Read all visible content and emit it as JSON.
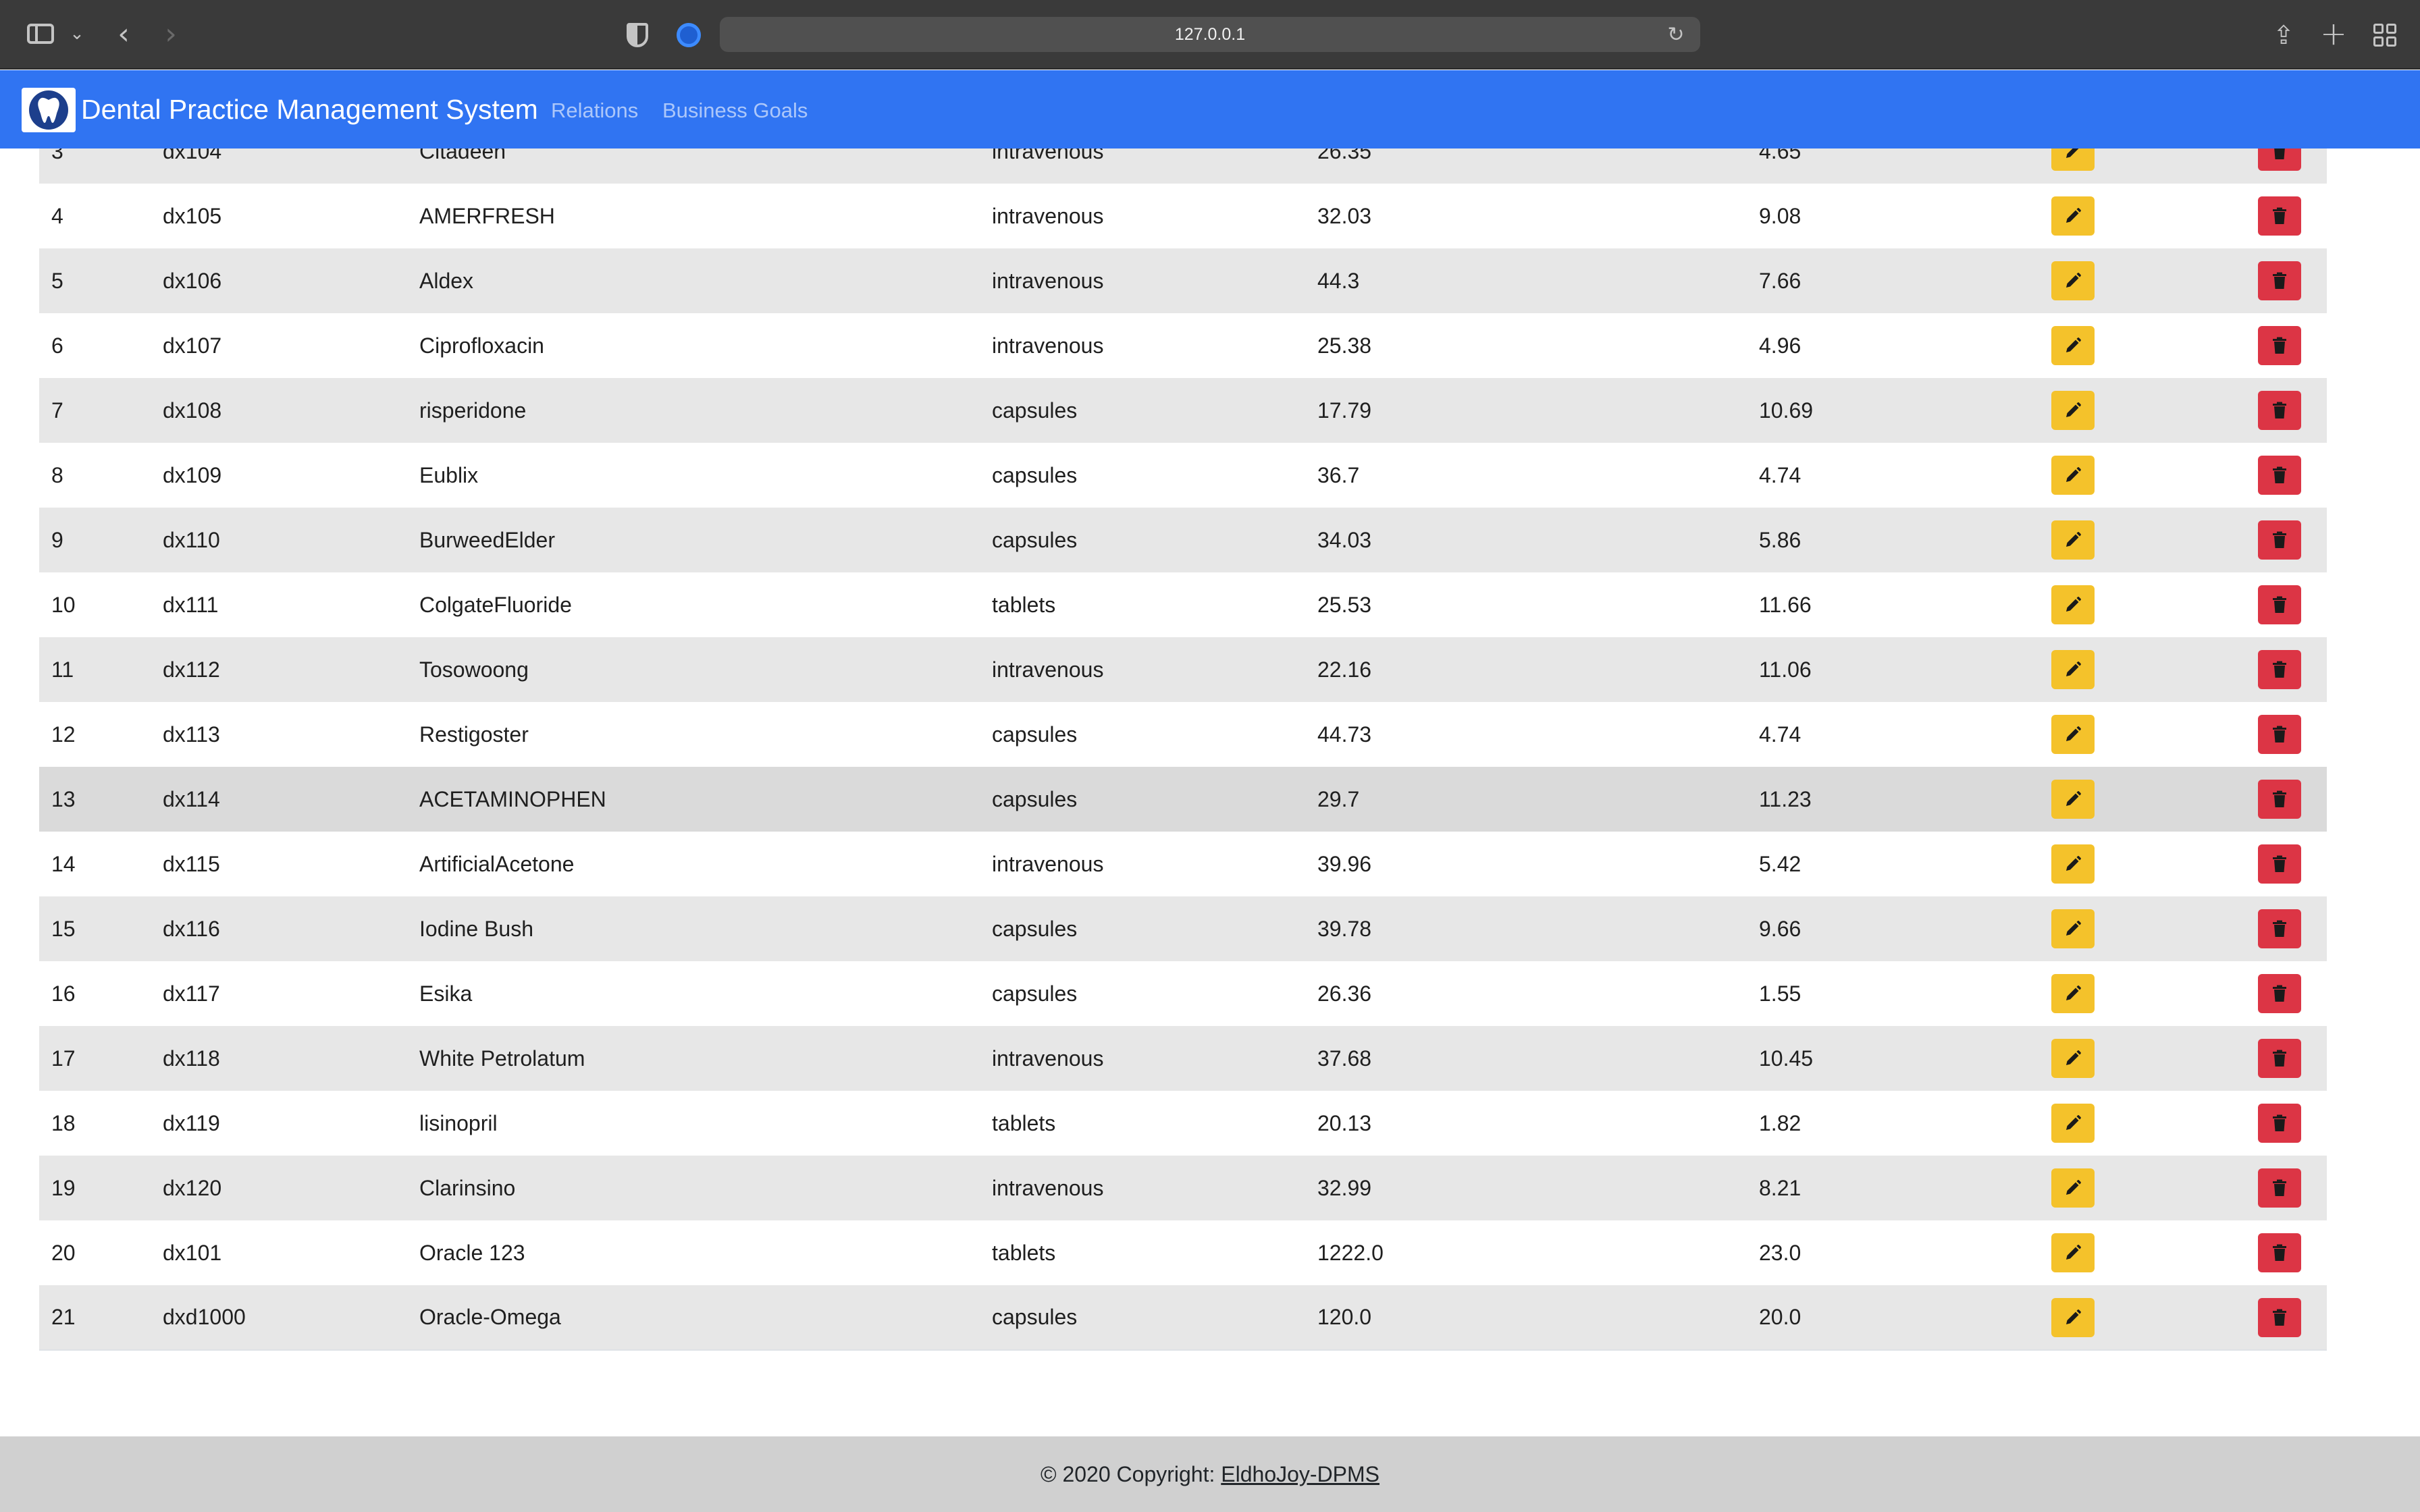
{
  "browser": {
    "url": "127.0.0.1"
  },
  "navbar": {
    "brand_title": "Dental Practice Management System",
    "links": [
      {
        "label": "Relations"
      },
      {
        "label": "Business Goals"
      }
    ],
    "brand_color": "#3074f2"
  },
  "table": {
    "rows": [
      {
        "n": "3",
        "code": "dx104",
        "name": "Citadeen",
        "type": "intravenous",
        "price": "26.35",
        "qty": "4.65"
      },
      {
        "n": "4",
        "code": "dx105",
        "name": "AMERFRESH",
        "type": "intravenous",
        "price": "32.03",
        "qty": "9.08"
      },
      {
        "n": "5",
        "code": "dx106",
        "name": "Aldex",
        "type": "intravenous",
        "price": "44.3",
        "qty": "7.66"
      },
      {
        "n": "6",
        "code": "dx107",
        "name": "Ciprofloxacin",
        "type": "intravenous",
        "price": "25.38",
        "qty": "4.96"
      },
      {
        "n": "7",
        "code": "dx108",
        "name": "risperidone",
        "type": "capsules",
        "price": "17.79",
        "qty": "10.69"
      },
      {
        "n": "8",
        "code": "dx109",
        "name": "Eublix",
        "type": "capsules",
        "price": "36.7",
        "qty": "4.74"
      },
      {
        "n": "9",
        "code": "dx110",
        "name": "BurweedElder",
        "type": "capsules",
        "price": "34.03",
        "qty": "5.86"
      },
      {
        "n": "10",
        "code": "dx111",
        "name": "ColgateFluoride",
        "type": "tablets",
        "price": "25.53",
        "qty": "11.66"
      },
      {
        "n": "11",
        "code": "dx112",
        "name": "Tosowoong",
        "type": "intravenous",
        "price": "22.16",
        "qty": "11.06"
      },
      {
        "n": "12",
        "code": "dx113",
        "name": "Restigoster",
        "type": "capsules",
        "price": "44.73",
        "qty": "4.74"
      },
      {
        "n": "13",
        "code": "dx114",
        "name": "ACETAMINOPHEN",
        "type": "capsules",
        "price": "29.7",
        "qty": "11.23"
      },
      {
        "n": "14",
        "code": "dx115",
        "name": "ArtificialAcetone",
        "type": "intravenous",
        "price": "39.96",
        "qty": "5.42"
      },
      {
        "n": "15",
        "code": "dx116",
        "name": "Iodine Bush",
        "type": "capsules",
        "price": "39.78",
        "qty": "9.66"
      },
      {
        "n": "16",
        "code": "dx117",
        "name": "Esika",
        "type": "capsules",
        "price": "26.36",
        "qty": "1.55"
      },
      {
        "n": "17",
        "code": "dx118",
        "name": "White Petrolatum",
        "type": "intravenous",
        "price": "37.68",
        "qty": "10.45"
      },
      {
        "n": "18",
        "code": "dx119",
        "name": "lisinopril",
        "type": "tablets",
        "price": "20.13",
        "qty": "1.82"
      },
      {
        "n": "19",
        "code": "dx120",
        "name": "Clarinsino",
        "type": "intravenous",
        "price": "32.99",
        "qty": "8.21"
      },
      {
        "n": "20",
        "code": "dx101",
        "name": "Oracle 123",
        "type": "tablets",
        "price": "1222.0",
        "qty": "23.0"
      },
      {
        "n": "21",
        "code": "dxd1000",
        "name": "Oracle-Omega",
        "type": "capsules",
        "price": "120.0",
        "qty": "20.0"
      }
    ],
    "edit_icon": "pencil-icon",
    "delete_icon": "trash-icon",
    "edit_color": "#f4c22b",
    "delete_color": "#dc3545"
  },
  "footer": {
    "prefix": "© 2020 Copyright: ",
    "link": "EldhoJoy-DPMS"
  }
}
